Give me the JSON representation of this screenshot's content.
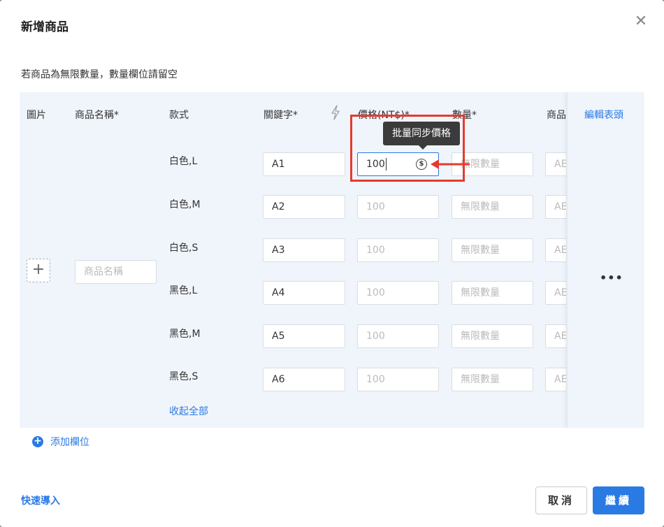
{
  "dialog": {
    "title": "新增商品",
    "close_glyph": "✕"
  },
  "hint": "若商品為無限數量，數量欄位請留空",
  "columns": {
    "image": "圖片",
    "name": "商品名稱*",
    "variant": "款式",
    "keyword": "關鍵字*",
    "price": "價格(NT$)*",
    "quantity": "數量*",
    "product_cut": "商品",
    "edit_header": "編輯表頭"
  },
  "name_placeholder": "商品名稱",
  "rows": [
    {
      "variant": "白色,L",
      "keyword": "A1",
      "price": "100",
      "qty_placeholder": "無限數量",
      "cut": "AE"
    },
    {
      "variant": "白色,M",
      "keyword": "A2",
      "price": "100",
      "qty_placeholder": "無限數量",
      "cut": "AE"
    },
    {
      "variant": "白色,S",
      "keyword": "A3",
      "price": "100",
      "qty_placeholder": "無限數量",
      "cut": "AE"
    },
    {
      "variant": "黑色,L",
      "keyword": "A4",
      "price": "100",
      "qty_placeholder": "無限數量",
      "cut": "AE"
    },
    {
      "variant": "黑色,M",
      "keyword": "A5",
      "price": "100",
      "qty_placeholder": "無限數量",
      "cut": "AE"
    },
    {
      "variant": "黑色,S",
      "keyword": "A6",
      "price": "100",
      "qty_placeholder": "無限數量",
      "cut": "AE"
    }
  ],
  "collapse_all": "收起全部",
  "tooltip": "批量同步價格",
  "more_glyph": "•••",
  "add_field": "添加欄位",
  "quick_import": "快速導入",
  "buttons": {
    "cancel": "取消",
    "continue": "繼續"
  },
  "colors": {
    "accent": "#2a7ae4",
    "highlight": "#e53a2f",
    "table_bg": "#f0f5fc",
    "tooltip_bg": "#3b3b3b"
  },
  "icons": {
    "bolt": "bolt-icon",
    "dollar": "dollar-coin-icon",
    "plus": "plus-icon",
    "close": "close-icon"
  }
}
